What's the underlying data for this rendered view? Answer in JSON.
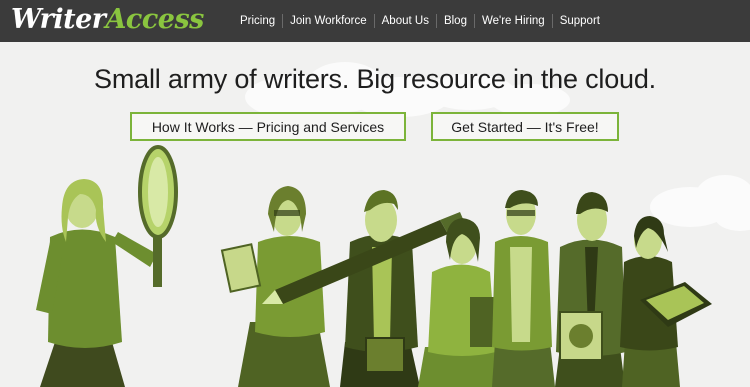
{
  "brand": {
    "part1": "Writer",
    "part2": "Access"
  },
  "nav": {
    "items": [
      {
        "label": "Pricing"
      },
      {
        "label": "Join Workforce"
      },
      {
        "label": "About Us"
      },
      {
        "label": "Blog"
      },
      {
        "label": "We're Hiring"
      },
      {
        "label": "Support"
      }
    ]
  },
  "hero": {
    "headline": "Small army of writers. Big resource in the cloud.",
    "cta_primary": "How It Works — Pricing and Services",
    "cta_secondary": "Get Started — It's Free!"
  },
  "colors": {
    "topbar": "#3b3b3b",
    "brand_green": "#8ac53f",
    "button_border": "#7cb43a",
    "background": "#f1f1f0"
  },
  "illustration": {
    "icons": [
      "magnifying-glass",
      "giant-pen",
      "book",
      "tablet",
      "folders"
    ]
  }
}
